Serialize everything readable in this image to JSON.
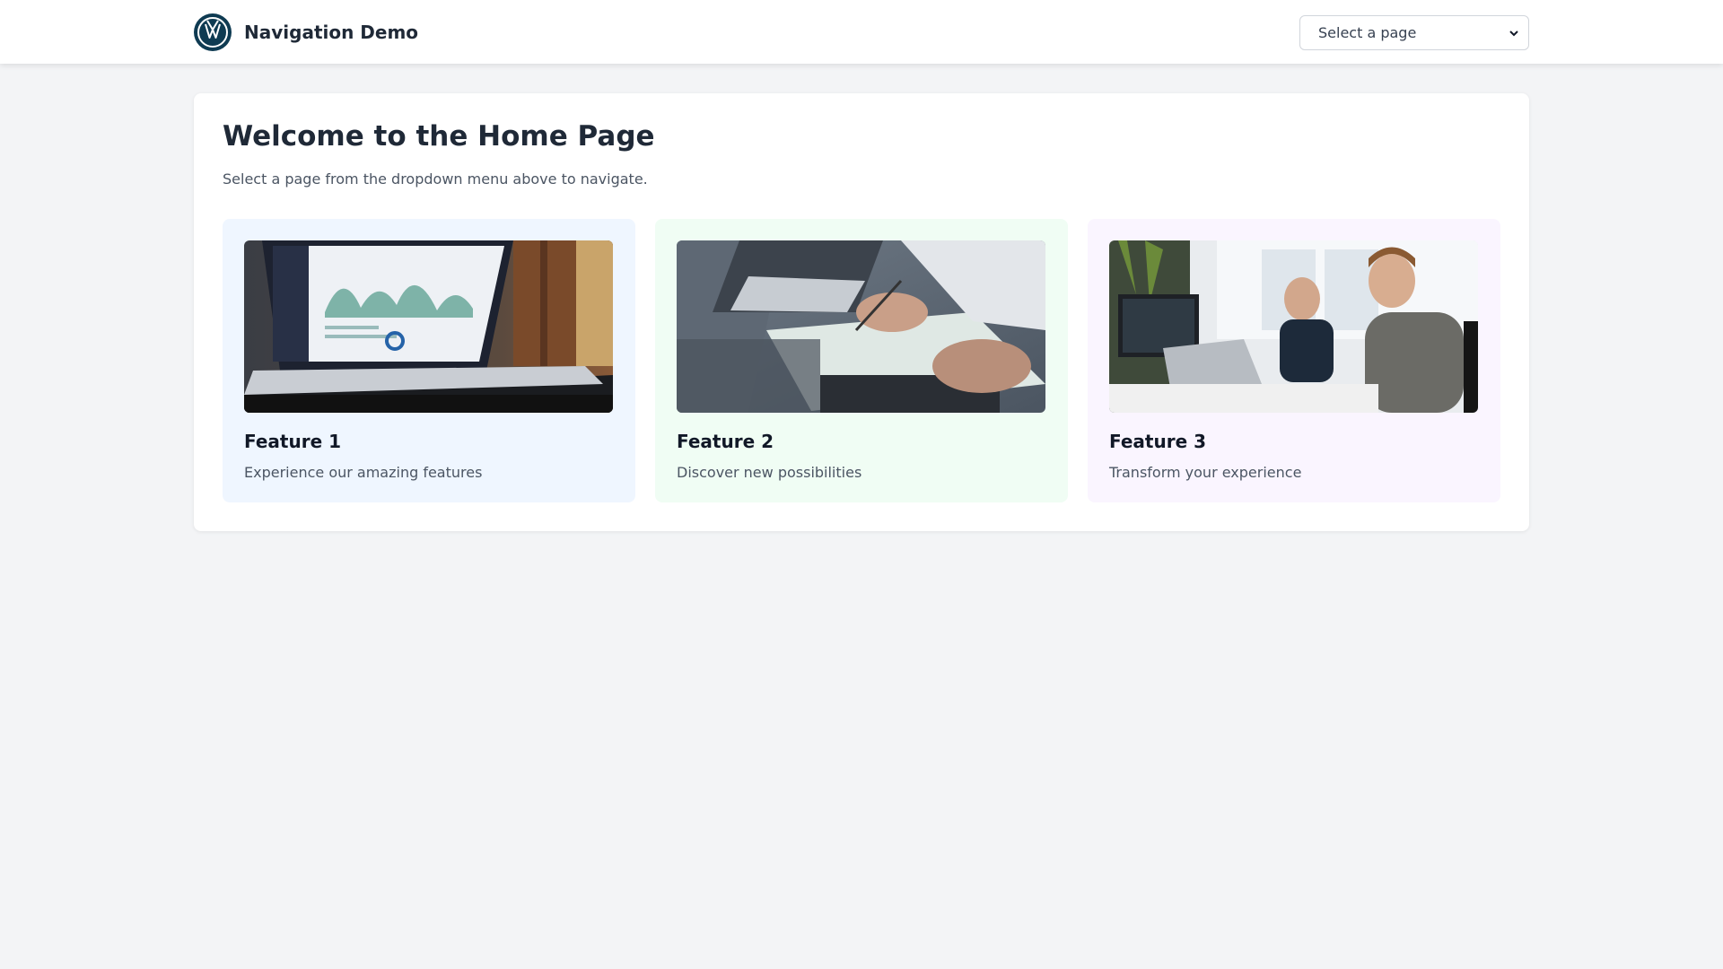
{
  "header": {
    "brand_title": "Navigation Demo",
    "logo_icon": "vw-logo-icon",
    "page_select": {
      "value": "Select a page"
    }
  },
  "main": {
    "title": "Welcome to the Home Page",
    "subtitle": "Select a page from the dropdown menu above to navigate."
  },
  "features": [
    {
      "title": "Feature 1",
      "description": "Experience our amazing features",
      "background": "#eff6ff"
    },
    {
      "title": "Feature 2",
      "description": "Discover new possibilities",
      "background": "#f0fdf4"
    },
    {
      "title": "Feature 3",
      "description": "Transform your experience",
      "background": "#faf5ff"
    }
  ]
}
